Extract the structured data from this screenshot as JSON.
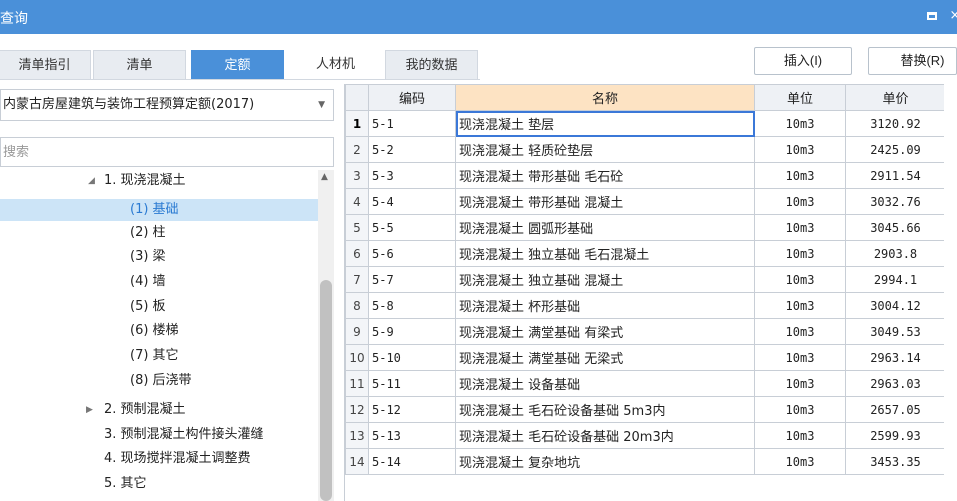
{
  "window": {
    "title": "查询",
    "maximize_icon": "maximize-icon",
    "close_icon": "close-icon",
    "close_glyph": "×"
  },
  "tabs": [
    {
      "label": "清单指引",
      "active": false
    },
    {
      "label": "清单",
      "active": false
    },
    {
      "label": "定额",
      "active": true
    },
    {
      "label": "人材机",
      "active": false
    },
    {
      "label": "我的数据",
      "active": false
    }
  ],
  "actions": {
    "insert_label": "插入(I)",
    "replace_label": "替换(R)"
  },
  "library": {
    "selected": "内蒙古房屋建筑与装饰工程预算定额(2017)"
  },
  "search": {
    "placeholder": "搜索",
    "value": ""
  },
  "tree": [
    {
      "label": "1. 现浇混凝土",
      "level": 1,
      "expanded": true,
      "selected": false
    },
    {
      "label": "(1) 基础",
      "level": 2,
      "selected": true
    },
    {
      "label": "(2) 柱",
      "level": 2,
      "selected": false
    },
    {
      "label": "(3) 梁",
      "level": 2,
      "selected": false
    },
    {
      "label": "(4) 墙",
      "level": 2,
      "selected": false
    },
    {
      "label": "(5) 板",
      "level": 2,
      "selected": false
    },
    {
      "label": "(6) 楼梯",
      "level": 2,
      "selected": false
    },
    {
      "label": "(7) 其它",
      "level": 2,
      "selected": false
    },
    {
      "label": "(8) 后浇带",
      "level": 2,
      "selected": false
    },
    {
      "label": "2. 预制混凝土",
      "level": 1,
      "expanded": false,
      "selected": false
    },
    {
      "label": "3. 预制混凝土构件接头灌缝",
      "level": 1,
      "selected": false
    },
    {
      "label": "4. 现场搅拌混凝土调整费",
      "level": 1,
      "selected": false
    },
    {
      "label": "5. 其它",
      "level": 1,
      "selected": false
    }
  ],
  "table": {
    "headers": {
      "code": "编码",
      "name": "名称",
      "unit": "单位",
      "price": "单价"
    },
    "rows": [
      {
        "num": "1",
        "code": "5-1",
        "name": "现浇混凝土 垫层",
        "unit": "10m3",
        "price": "3120.92"
      },
      {
        "num": "2",
        "code": "5-2",
        "name": "现浇混凝土 轻质砼垫层",
        "unit": "10m3",
        "price": "2425.09"
      },
      {
        "num": "3",
        "code": "5-3",
        "name": "现浇混凝土 带形基础 毛石砼",
        "unit": "10m3",
        "price": "2911.54"
      },
      {
        "num": "4",
        "code": "5-4",
        "name": "现浇混凝土 带形基础 混凝土",
        "unit": "10m3",
        "price": "3032.76"
      },
      {
        "num": "5",
        "code": "5-5",
        "name": "现浇混凝土 圆弧形基础",
        "unit": "10m3",
        "price": "3045.66"
      },
      {
        "num": "6",
        "code": "5-6",
        "name": "现浇混凝土 独立基础 毛石混凝土",
        "unit": "10m3",
        "price": "2903.8"
      },
      {
        "num": "7",
        "code": "5-7",
        "name": "现浇混凝土 独立基础 混凝土",
        "unit": "10m3",
        "price": "2994.1"
      },
      {
        "num": "8",
        "code": "5-8",
        "name": "现浇混凝土 杯形基础",
        "unit": "10m3",
        "price": "3004.12"
      },
      {
        "num": "9",
        "code": "5-9",
        "name": "现浇混凝土 满堂基础 有梁式",
        "unit": "10m3",
        "price": "3049.53"
      },
      {
        "num": "10",
        "code": "5-10",
        "name": "现浇混凝土 满堂基础 无梁式",
        "unit": "10m3",
        "price": "2963.14"
      },
      {
        "num": "11",
        "code": "5-11",
        "name": "现浇混凝土 设备基础",
        "unit": "10m3",
        "price": "2963.03"
      },
      {
        "num": "12",
        "code": "5-12",
        "name": "现浇混凝土 毛石砼设备基础 5m3内",
        "unit": "10m3",
        "price": "2657.05"
      },
      {
        "num": "13",
        "code": "5-13",
        "name": "现浇混凝土 毛石砼设备基础 20m3内",
        "unit": "10m3",
        "price": "2599.93"
      },
      {
        "num": "14",
        "code": "5-14",
        "name": "现浇混凝土 复杂地坑",
        "unit": "10m3",
        "price": "3453.35"
      }
    ]
  }
}
